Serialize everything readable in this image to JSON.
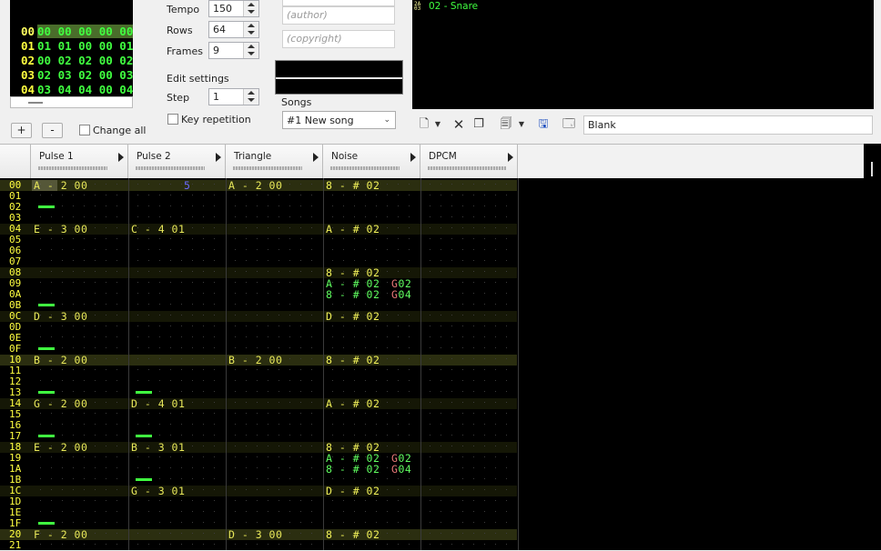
{
  "frames": [
    {
      "num": "00",
      "patterns": [
        "00",
        "00",
        "00",
        "00",
        "00"
      ],
      "selected": true
    },
    {
      "num": "01",
      "patterns": [
        "01",
        "01",
        "00",
        "00",
        "01"
      ],
      "selected": false
    },
    {
      "num": "02",
      "patterns": [
        "00",
        "02",
        "02",
        "00",
        "02"
      ],
      "selected": false
    },
    {
      "num": "03",
      "patterns": [
        "02",
        "03",
        "02",
        "00",
        "03"
      ],
      "selected": false
    },
    {
      "num": "04",
      "patterns": [
        "03",
        "04",
        "04",
        "00",
        "04"
      ],
      "selected": false
    }
  ],
  "frame_controls": {
    "add": "+",
    "remove": "-",
    "change_all": "Change all"
  },
  "song_settings": {
    "tempo_label": "Tempo",
    "tempo_value": "150",
    "rows_label": "Rows",
    "rows_value": "64",
    "frames_label": "Frames",
    "frames_value": "9"
  },
  "edit_settings": {
    "group_label": "Edit settings",
    "step_label": "Step",
    "step_value": "1",
    "key_repetition": "Key repetition"
  },
  "song_info": {
    "author_placeholder": "(author)",
    "copyright_placeholder": "(copyright)"
  },
  "songs": {
    "label": "Songs",
    "selected": "#1 New song"
  },
  "instruments": {
    "items": [
      {
        "label": "02 - Snare"
      }
    ],
    "name_value": "Blank"
  },
  "channels": [
    "Pulse 1",
    "Pulse 2",
    "Triangle",
    "Noise",
    "DPCM"
  ],
  "rows": [
    "00",
    "01",
    "02",
    "03",
    "04",
    "05",
    "06",
    "07",
    "08",
    "09",
    "0A",
    "0B",
    "0C",
    "0D",
    "0E",
    "0F",
    "10",
    "11",
    "12",
    "13",
    "14",
    "15",
    "16",
    "17",
    "18",
    "19",
    "1A",
    "1B",
    "1C",
    "1D",
    "1E",
    "1F",
    "20",
    "21"
  ],
  "cells": [
    {
      "row": 0,
      "col": 0,
      "note": "A-2",
      "inst": "00"
    },
    {
      "row": 0,
      "col": 1,
      "vol": "5"
    },
    {
      "row": 0,
      "col": 2,
      "note": "A-2",
      "inst": "00"
    },
    {
      "row": 0,
      "col": 3,
      "note": "8-#",
      "inst": "02"
    },
    {
      "row": 4,
      "col": 0,
      "note": "E-3",
      "inst": "00"
    },
    {
      "row": 4,
      "col": 1,
      "note": "C-4",
      "inst": "01"
    },
    {
      "row": 4,
      "col": 3,
      "note": "A-#",
      "inst": "02"
    },
    {
      "row": 8,
      "col": 3,
      "note": "8-#",
      "inst": "02"
    },
    {
      "row": 9,
      "col": 3,
      "note": "A-#",
      "inst": "02",
      "eff": "G",
      "effv": "02",
      "alt": true
    },
    {
      "row": 10,
      "col": 3,
      "note": "8-#",
      "inst": "02",
      "eff": "G",
      "effv": "04",
      "alt": true
    },
    {
      "row": 12,
      "col": 0,
      "note": "D-3",
      "inst": "00"
    },
    {
      "row": 12,
      "col": 3,
      "note": "D-#",
      "inst": "02"
    },
    {
      "row": 16,
      "col": 0,
      "note": "B-2",
      "inst": "00"
    },
    {
      "row": 16,
      "col": 2,
      "note": "B-2",
      "inst": "00"
    },
    {
      "row": 16,
      "col": 3,
      "note": "8-#",
      "inst": "02"
    },
    {
      "row": 20,
      "col": 0,
      "note": "G-2",
      "inst": "00"
    },
    {
      "row": 20,
      "col": 1,
      "note": "D-4",
      "inst": "01"
    },
    {
      "row": 20,
      "col": 3,
      "note": "A-#",
      "inst": "02"
    },
    {
      "row": 24,
      "col": 0,
      "note": "E-2",
      "inst": "00"
    },
    {
      "row": 24,
      "col": 1,
      "note": "B-3",
      "inst": "01"
    },
    {
      "row": 24,
      "col": 3,
      "note": "8-#",
      "inst": "02"
    },
    {
      "row": 25,
      "col": 3,
      "note": "A-#",
      "inst": "02",
      "eff": "G",
      "effv": "02",
      "alt": true
    },
    {
      "row": 26,
      "col": 3,
      "note": "8-#",
      "inst": "02",
      "eff": "G",
      "effv": "04",
      "alt": true
    },
    {
      "row": 28,
      "col": 1,
      "note": "G-3",
      "inst": "01"
    },
    {
      "row": 28,
      "col": 3,
      "note": "D-#",
      "inst": "02"
    },
    {
      "row": 32,
      "col": 0,
      "note": "F-2",
      "inst": "00"
    },
    {
      "row": 32,
      "col": 2,
      "note": "D-3",
      "inst": "00"
    },
    {
      "row": 32,
      "col": 3,
      "note": "8-#",
      "inst": "02"
    }
  ],
  "releases": [
    {
      "row": 2,
      "col": 0
    },
    {
      "row": 11,
      "col": 0
    },
    {
      "row": 15,
      "col": 0
    },
    {
      "row": 19,
      "col": 0
    },
    {
      "row": 19,
      "col": 1
    },
    {
      "row": 23,
      "col": 0
    },
    {
      "row": 23,
      "col": 1
    },
    {
      "row": 27,
      "col": 1
    },
    {
      "row": 31,
      "col": 0
    }
  ]
}
